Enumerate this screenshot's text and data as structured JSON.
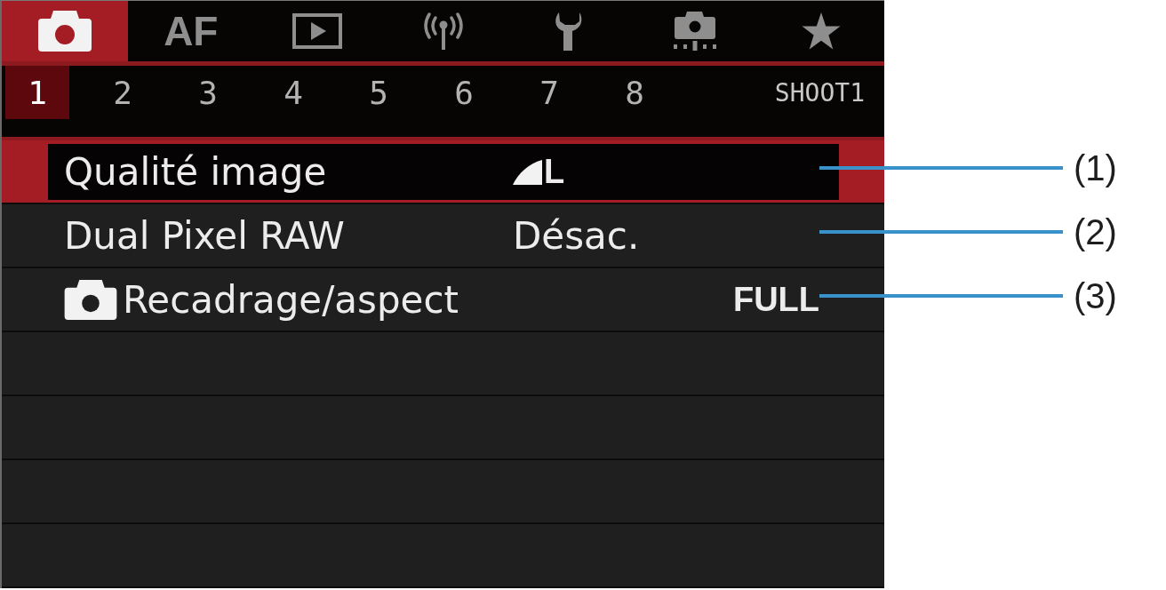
{
  "tabs": [
    {
      "kind": "camera",
      "selected": true
    },
    {
      "kind": "text",
      "label": "AF",
      "selected": false
    },
    {
      "kind": "playback",
      "selected": false
    },
    {
      "kind": "wireless",
      "selected": false
    },
    {
      "kind": "wrench",
      "selected": false
    },
    {
      "kind": "custom",
      "selected": false
    },
    {
      "kind": "star",
      "selected": false
    }
  ],
  "sub_tabs": [
    {
      "label": "1",
      "selected": true
    },
    {
      "label": "2",
      "selected": false
    },
    {
      "label": "3",
      "selected": false
    },
    {
      "label": "4",
      "selected": false
    },
    {
      "label": "5",
      "selected": false
    },
    {
      "label": "6",
      "selected": false
    },
    {
      "label": "7",
      "selected": false
    },
    {
      "label": "8",
      "selected": false
    }
  ],
  "page_name": "SHOOT1",
  "menu": {
    "rows": [
      {
        "kind": "quality",
        "label": "Qualité image",
        "value": "L",
        "selected": true
      },
      {
        "kind": "plain",
        "label": "Dual Pixel RAW",
        "value": "Désac.",
        "selected": false
      },
      {
        "kind": "still",
        "label": "Recadrage/aspect",
        "value": "FULL",
        "selected": false
      }
    ]
  },
  "callouts": [
    "(1)",
    "(2)",
    "(3)"
  ]
}
